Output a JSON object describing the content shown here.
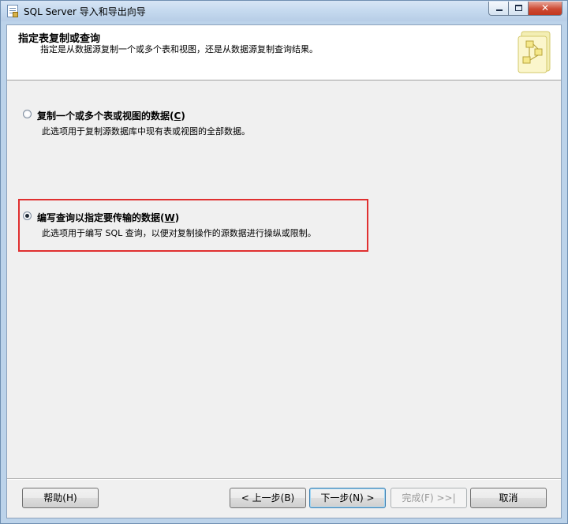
{
  "window": {
    "title": "SQL Server 导入和导出向导"
  },
  "header": {
    "title": "指定表复制或查询",
    "subtitle": "指定是从数据源复制一个或多个表和视图，还是从数据源复制查询结果。"
  },
  "options": [
    {
      "label": "复制一个或多个表或视图的数据",
      "hotkey": "C",
      "description": "此选项用于复制源数据库中现有表或视图的全部数据。",
      "selected": false
    },
    {
      "label": "编写查询以指定要传输的数据",
      "hotkey": "W",
      "description": "此选项用于编写 SQL 查询，以便对复制操作的源数据进行操纵或限制。",
      "selected": true
    }
  ],
  "buttons": {
    "help": "帮助(H)",
    "back": "< 上一步(B)",
    "next": "下一步(N) >",
    "finish": "完成(F) >>|",
    "cancel": "取消"
  },
  "colors": {
    "highlight_border": "#e03030",
    "titlebar": "#c3d8ee",
    "close_button": "#cd4a33"
  }
}
